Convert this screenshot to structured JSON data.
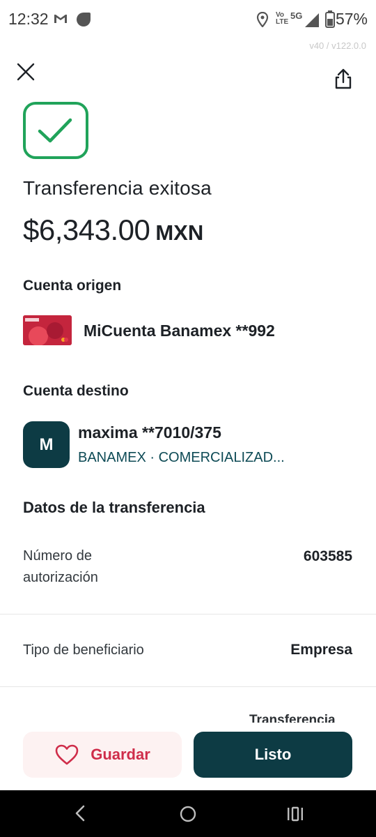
{
  "status_bar": {
    "time": "12:32",
    "network_lte": "Vo LTE",
    "network_5g": "5G",
    "battery": "57%"
  },
  "version": "v40 / v122.0.0",
  "header": {
    "close_icon": "close-icon",
    "share_icon": "share-icon"
  },
  "result": {
    "title": "Transferencia exitosa",
    "amount": "$6,343.00",
    "currency": "MXN"
  },
  "origin": {
    "section_label": "Cuenta origen",
    "account_name": "MiCuenta Banamex **992"
  },
  "destination": {
    "section_label": "Cuenta destino",
    "avatar_initial": "M",
    "name": "maxima **7010/375",
    "bank": "BANAMEX · COMERCIALIZAD..."
  },
  "details": {
    "section_label": "Datos de la transferencia",
    "rows": [
      {
        "label_line1": "Número de",
        "label_line2": "autorización",
        "value": "603585"
      },
      {
        "label": "Tipo de beneficiario",
        "value": "Empresa"
      }
    ],
    "partial_value": "Transferencia"
  },
  "actions": {
    "save_label": "Guardar",
    "done_label": "Listo"
  },
  "colors": {
    "success_green": "#20a35a",
    "primary_dark": "#0d3b44",
    "save_red": "#cf2d4a",
    "save_bg": "#fdf2f2"
  }
}
